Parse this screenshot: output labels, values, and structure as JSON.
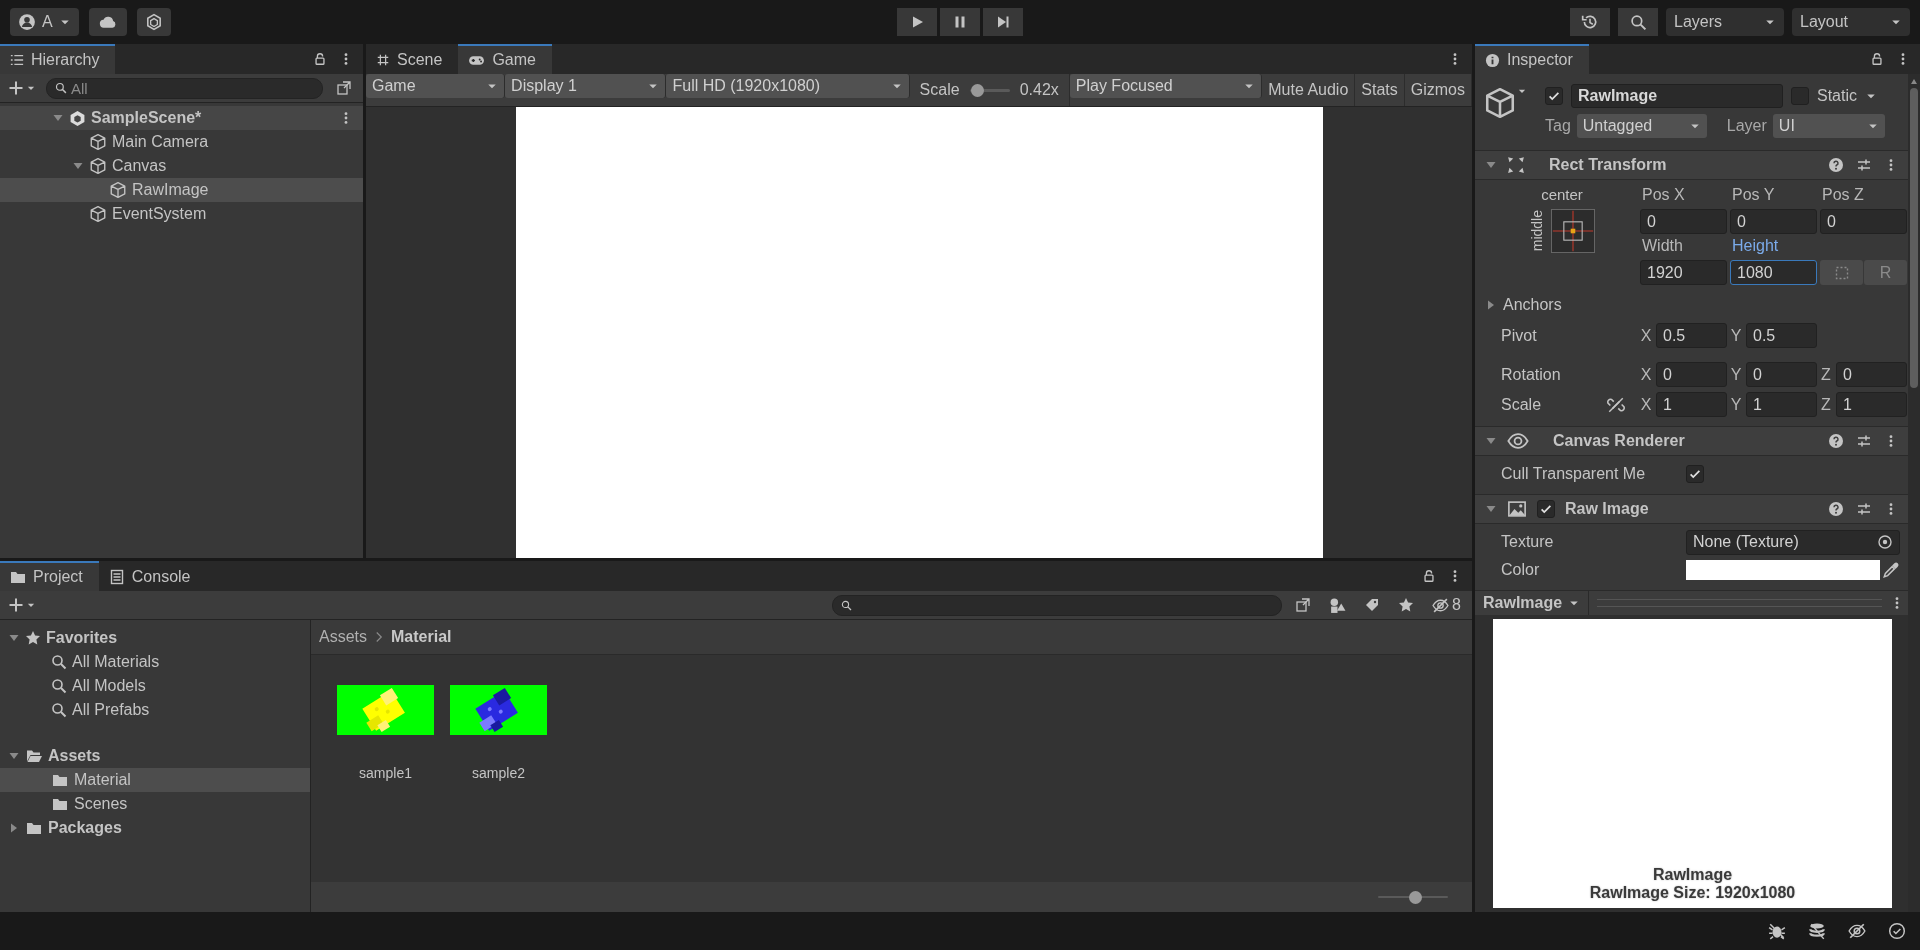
{
  "toolbar": {
    "account": "A",
    "layers": "Layers",
    "layout": "Layout"
  },
  "hierarchy": {
    "title": "Hierarchy",
    "search_placeholder": "All",
    "tree": [
      {
        "label": "SampleScene*",
        "kind": "scene",
        "expanded": true,
        "selected": false,
        "children": [
          {
            "label": "Main Camera",
            "kind": "object",
            "selected": false
          },
          {
            "label": "Canvas",
            "kind": "object",
            "expanded": true,
            "selected": false,
            "children": [
              {
                "label": "RawImage",
                "kind": "object",
                "selected": true
              }
            ]
          },
          {
            "label": "EventSystem",
            "kind": "object",
            "selected": false
          }
        ]
      }
    ]
  },
  "game": {
    "tabs": [
      {
        "label": "Scene",
        "kind": "scene",
        "selected": false
      },
      {
        "label": "Game",
        "kind": "game",
        "selected": true
      }
    ],
    "controls": [
      {
        "kind": "dropdown",
        "label": "Game"
      },
      {
        "kind": "dropdown",
        "label": "Display 1"
      },
      {
        "kind": "dropdown",
        "label": "Full HD (1920x1080)"
      },
      {
        "kind": "slider",
        "label": "Scale",
        "level": 0.05,
        "reading": "0.42x"
      },
      {
        "kind": "dropdown",
        "label": "Play Focused"
      },
      {
        "kind": "toggle",
        "label": "Mute Audio"
      },
      {
        "kind": "toggle",
        "label": "Stats"
      },
      {
        "kind": "toggle",
        "label": "Gizmos"
      }
    ]
  },
  "project": {
    "tabs": [
      {
        "label": "Project",
        "kind": "project",
        "selected": true
      },
      {
        "label": "Console",
        "kind": "console",
        "selected": false
      }
    ],
    "hidden_count": "8",
    "tree": [
      {
        "label": "Favorites",
        "kind": "favorites",
        "expanded": true,
        "selected": false,
        "children": [
          {
            "label": "All Materials",
            "kind": "search",
            "selected": false
          },
          {
            "label": "All Models",
            "kind": "search",
            "selected": false
          },
          {
            "label": "All Prefabs",
            "kind": "search",
            "selected": false
          }
        ]
      },
      {
        "label": "Assets",
        "kind": "folder",
        "expanded": true,
        "selected": false,
        "children": [
          {
            "label": "Material",
            "kind": "folder",
            "selected": true
          },
          {
            "label": "Scenes",
            "kind": "folder",
            "selected": false
          }
        ]
      },
      {
        "label": "Packages",
        "kind": "folder",
        "expanded": false,
        "selected": false
      }
    ],
    "breadcrumb": [
      "Assets",
      "Material"
    ],
    "assets": [
      {
        "name": "sample1",
        "kind": "picture"
      },
      {
        "name": "sample2",
        "kind": "picture"
      }
    ],
    "icon_size": {
      "level": 0.55
    }
  },
  "inspector": {
    "title": "Inspector",
    "object": {
      "active": true,
      "name": "RawImage",
      "static": false,
      "static_label": "Static",
      "tag_label": "Tag",
      "tag": "Untagged",
      "layer_label": "Layer",
      "layer": "UI"
    },
    "rect_transform": {
      "title": "Rect Transform",
      "expanded": true,
      "anchor_h": "center",
      "anchor_v": "middle",
      "position": [
        {
          "label": "Pos X",
          "value": "0",
          "focused": false
        },
        {
          "label": "Pos Y",
          "value": "0",
          "focused": false
        },
        {
          "label": "Pos Z",
          "value": "0",
          "focused": false
        }
      ],
      "size": [
        {
          "label": "Width",
          "value": "1920",
          "focused": false
        },
        {
          "label": "Height",
          "value": "1080",
          "focused": true
        }
      ],
      "raw_button": "R",
      "anchors": {
        "label": "Anchors",
        "expanded": false
      },
      "vectors": [
        {
          "label": "Pivot",
          "kind": "plain",
          "axes": [
            {
              "axis": "X",
              "value": "0.5"
            },
            {
              "axis": "Y",
              "value": "0.5"
            }
          ]
        },
        {
          "label": "Rotation",
          "kind": "plain",
          "axes": [
            {
              "axis": "X",
              "value": "0"
            },
            {
              "axis": "Y",
              "value": "0"
            },
            {
              "axis": "Z",
              "value": "0"
            }
          ]
        },
        {
          "label": "Scale",
          "kind": "linked",
          "axes": [
            {
              "axis": "X",
              "value": "1"
            },
            {
              "axis": "Y",
              "value": "1"
            },
            {
              "axis": "Z",
              "value": "1"
            }
          ]
        }
      ]
    },
    "components": [
      {
        "title": "Canvas Renderer",
        "kind": "canvas_renderer",
        "expanded": true,
        "fields": [
          {
            "label": "Cull Transparent Me",
            "kind": "checkbox",
            "checked": true
          }
        ]
      },
      {
        "title": "Raw Image",
        "kind": "raw_image",
        "expanded": true,
        "enabled": true,
        "fields": [
          {
            "label": "Texture",
            "kind": "object",
            "value": "None (Texture)"
          },
          {
            "label": "Color",
            "kind": "color",
            "color": "#ffffff"
          }
        ]
      }
    ],
    "preview": {
      "title": "RawImage",
      "captions": [
        "RawImage",
        "RawImage Size: 1920x1080"
      ]
    }
  }
}
